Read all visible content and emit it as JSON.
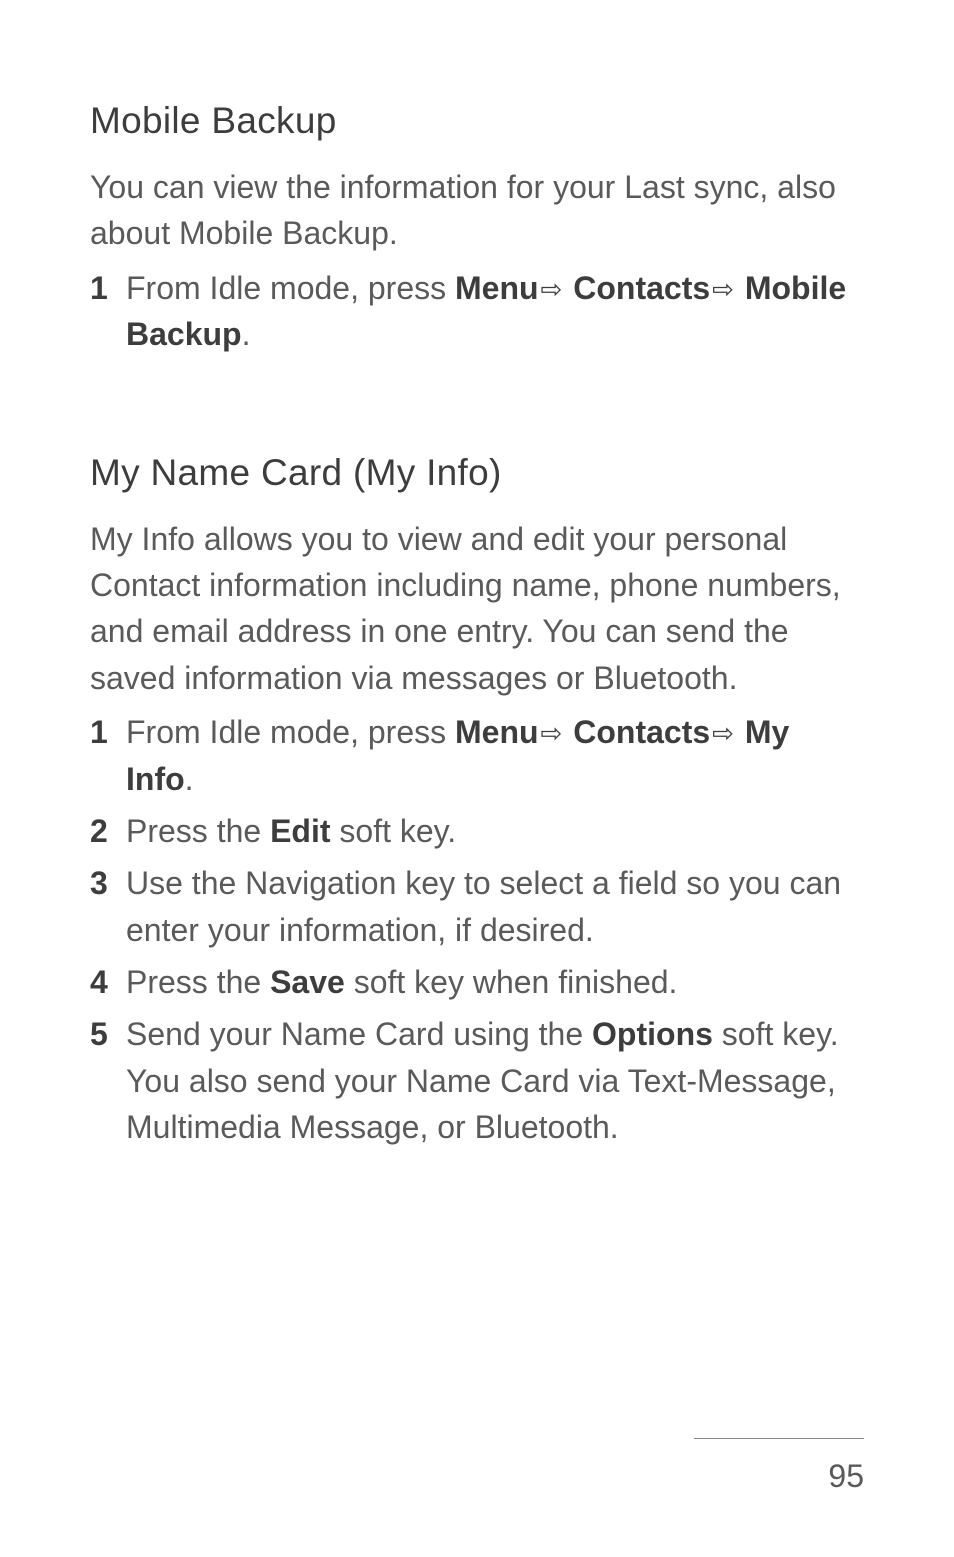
{
  "sections": [
    {
      "heading": "Mobile Backup",
      "intro": "You can view the information for your Last sync, also about Mobile Backup.",
      "steps": [
        {
          "parts": [
            {
              "t": "From Idle mode, press "
            },
            {
              "t": "Menu",
              "b": true
            },
            {
              "arrow": true
            },
            {
              "t": "Contacts",
              "b": true
            },
            {
              "arrow": true
            },
            {
              "t": "Mobile Backup",
              "b": true
            },
            {
              "t": "."
            }
          ]
        }
      ]
    },
    {
      "heading": "My Name Card (My Info)",
      "intro": "My Info allows you to view and edit your personal Contact information including name, phone numbers, and email address in one entry. You can send the saved information via messages or Bluetooth.",
      "steps": [
        {
          "parts": [
            {
              "t": "From Idle mode, press "
            },
            {
              "t": "Menu",
              "b": true
            },
            {
              "arrow": true
            },
            {
              "t": "Contacts",
              "b": true
            },
            {
              "arrow": true
            },
            {
              "t": "My Info",
              "b": true
            },
            {
              "t": "."
            }
          ]
        },
        {
          "parts": [
            {
              "t": "Press the "
            },
            {
              "t": "Edit",
              "b": true
            },
            {
              "t": " soft key."
            }
          ]
        },
        {
          "parts": [
            {
              "t": "Use the Navigation key to select a field so you can enter your information, if desired."
            }
          ]
        },
        {
          "parts": [
            {
              "t": "Press the "
            },
            {
              "t": "Save",
              "b": true
            },
            {
              "t": " soft key when finished."
            }
          ]
        },
        {
          "parts": [
            {
              "t": "Send your Name Card using the "
            },
            {
              "t": "Options",
              "b": true
            },
            {
              "t": " soft key. You also send your Name Card via Text-Message, Multimedia Message, or Bluetooth."
            }
          ]
        }
      ]
    }
  ],
  "page_number": "95",
  "arrow_glyph": "⇨"
}
